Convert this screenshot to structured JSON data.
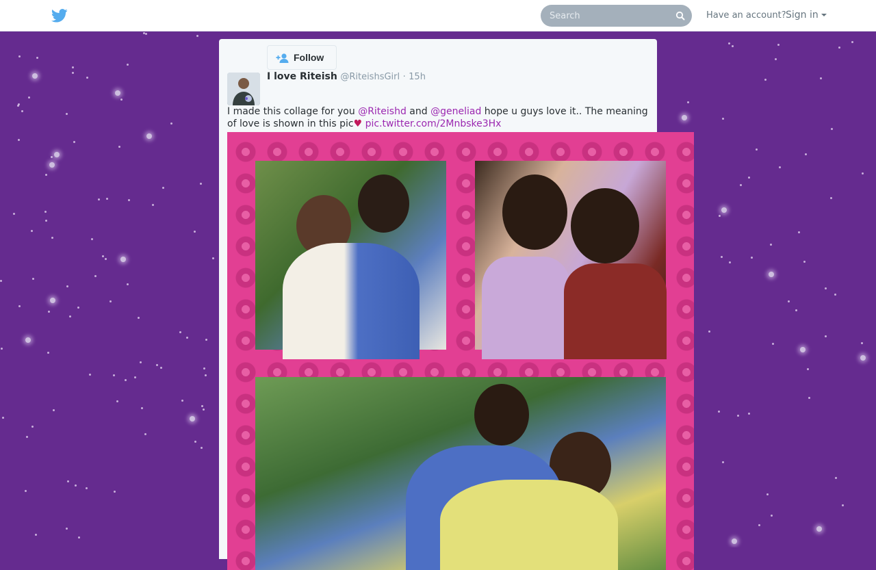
{
  "header": {
    "logo_icon": "twitter-bird-icon",
    "search_placeholder": "Search",
    "have_account": "Have an account?",
    "sign_in": "Sign in"
  },
  "tweet": {
    "follow_label": "Follow",
    "author_name": "I love Riteish",
    "handle": "@RiteishsGirl",
    "separator": "·",
    "time": "15h",
    "text_part1": "I made this collage for you ",
    "mention1": "@Riteishd",
    "text_part2": " and ",
    "mention2": "@geneliad",
    "text_part3": " hope u guys love it.. The meaning of love is shown in this pic",
    "heart": "♥",
    "pic_link": "pic.twitter.com/2Mnbske3Hx"
  },
  "colors": {
    "background": "#652b8f",
    "link": "#9b27b0",
    "accent": "#55acee",
    "collage_border": "#e23f93"
  }
}
